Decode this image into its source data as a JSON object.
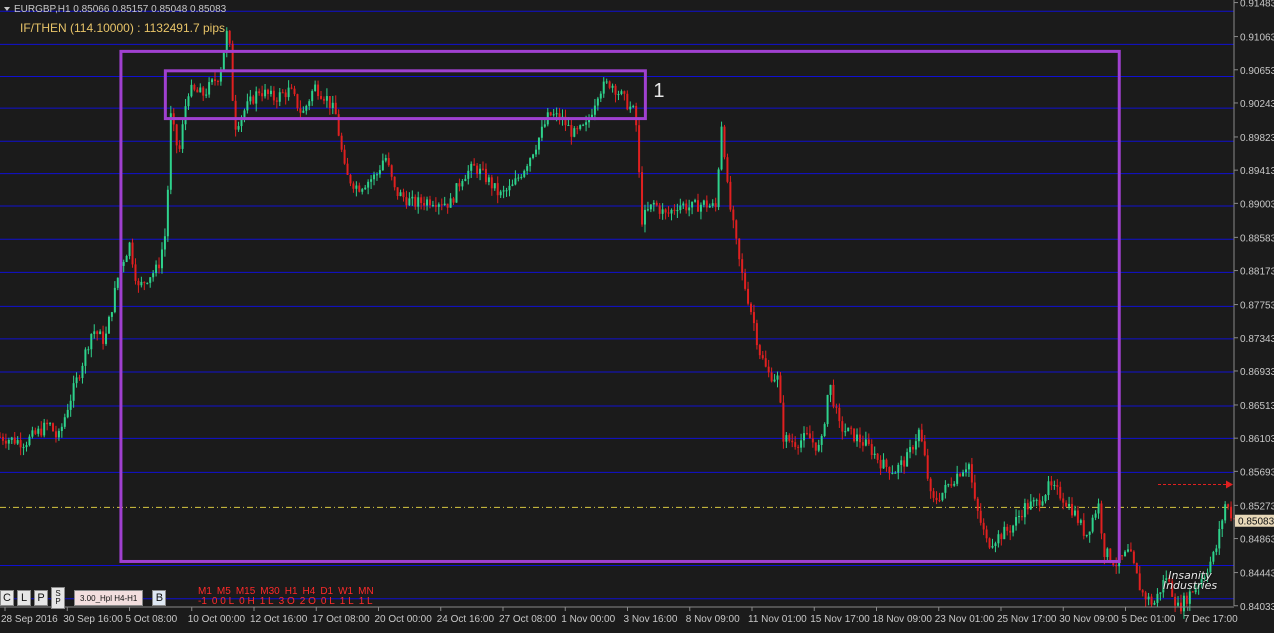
{
  "header": {
    "symbol_line": "EURGBP,H1  0.85066 0.85157 0.85048 0.85083",
    "indicator_line": "IF/THEN (114.10000) : 1132491.7 pips"
  },
  "chart_data": {
    "type": "candlestick",
    "symbol": "EURGBP",
    "timeframe": "H1",
    "ohlc_last": {
      "open": 0.85066,
      "high": 0.85157,
      "low": 0.85048,
      "close": 0.85083
    },
    "ylim": [
      0.8403,
      0.9149
    ],
    "yticks": [
      "0.91483",
      "0.91063",
      "0.90653",
      "0.90243",
      "0.89823",
      "0.89413",
      "0.89003",
      "0.88583",
      "0.88173",
      "0.87753",
      "0.87343",
      "0.86933",
      "0.86513",
      "0.86103",
      "0.85693",
      "0.85273",
      "0.84863",
      "0.84443",
      "0.84033"
    ],
    "xticks": [
      "28 Sep 2016",
      "30 Sep 16:00",
      "5 Oct 08:00",
      "10 Oct 00:00",
      "12 Oct 16:00",
      "17 Oct 08:00",
      "20 Oct 00:00",
      "24 Oct 16:00",
      "27 Oct 08:00",
      "1 Nov 00:00",
      "3 Nov 16:00",
      "8 Nov 09:00",
      "11 Nov 01:00",
      "15 Nov 17:00",
      "18 Nov 09:00",
      "23 Nov 01:00",
      "25 Nov 17:00",
      "30 Nov 09:00",
      "5 Dec 01:00",
      "7 Dec 17:00"
    ],
    "horizontal_levels": [
      0.91376,
      0.90966,
      0.9057,
      0.9018,
      0.8977,
      0.8937,
      0.8897,
      0.8856,
      0.8815,
      0.8773,
      0.8733,
      0.8692,
      0.865,
      0.861,
      0.8568,
      0.8453,
      0.8412
    ],
    "support_level": 0.85248,
    "bid_price": "0.85083",
    "path": [
      [
        0.0,
        0.8612
      ],
      [
        0.02,
        0.8605
      ],
      [
        0.04,
        0.8628
      ],
      [
        0.047,
        0.8608
      ],
      [
        0.055,
        0.865
      ],
      [
        0.064,
        0.869
      ],
      [
        0.075,
        0.8745
      ],
      [
        0.085,
        0.873
      ],
      [
        0.097,
        0.882
      ],
      [
        0.105,
        0.885
      ],
      [
        0.112,
        0.8795
      ],
      [
        0.12,
        0.881
      ],
      [
        0.128,
        0.882
      ],
      [
        0.135,
        0.887
      ],
      [
        0.138,
        0.901
      ],
      [
        0.145,
        0.896
      ],
      [
        0.152,
        0.904
      ],
      [
        0.165,
        0.9035
      ],
      [
        0.178,
        0.906
      ],
      [
        0.185,
        0.912
      ],
      [
        0.19,
        0.8995
      ],
      [
        0.198,
        0.9015
      ],
      [
        0.21,
        0.904
      ],
      [
        0.222,
        0.903
      ],
      [
        0.235,
        0.904
      ],
      [
        0.245,
        0.901
      ],
      [
        0.255,
        0.9045
      ],
      [
        0.265,
        0.903
      ],
      [
        0.272,
        0.901
      ],
      [
        0.28,
        0.8935
      ],
      [
        0.29,
        0.892
      ],
      [
        0.305,
        0.8935
      ],
      [
        0.312,
        0.896
      ],
      [
        0.32,
        0.8915
      ],
      [
        0.335,
        0.89
      ],
      [
        0.35,
        0.8905
      ],
      [
        0.365,
        0.89
      ],
      [
        0.375,
        0.8935
      ],
      [
        0.385,
        0.8945
      ],
      [
        0.395,
        0.893
      ],
      [
        0.405,
        0.891
      ],
      [
        0.415,
        0.892
      ],
      [
        0.425,
        0.8945
      ],
      [
        0.435,
        0.8975
      ],
      [
        0.445,
        0.901
      ],
      [
        0.455,
        0.9005
      ],
      [
        0.465,
        0.8985
      ],
      [
        0.475,
        0.8995
      ],
      [
        0.485,
        0.904
      ],
      [
        0.495,
        0.905
      ],
      [
        0.505,
        0.903
      ],
      [
        0.515,
        0.901
      ],
      [
        0.52,
        0.888
      ],
      [
        0.53,
        0.89
      ],
      [
        0.54,
        0.8885
      ],
      [
        0.55,
        0.89
      ],
      [
        0.56,
        0.8895
      ],
      [
        0.57,
        0.89
      ],
      [
        0.58,
        0.8895
      ],
      [
        0.585,
        0.9005
      ],
      [
        0.59,
        0.891
      ],
      [
        0.6,
        0.882
      ],
      [
        0.61,
        0.876
      ],
      [
        0.615,
        0.872
      ],
      [
        0.622,
        0.869
      ],
      [
        0.63,
        0.8685
      ],
      [
        0.635,
        0.861
      ],
      [
        0.645,
        0.8605
      ],
      [
        0.655,
        0.8612
      ],
      [
        0.665,
        0.8595
      ],
      [
        0.672,
        0.868
      ],
      [
        0.68,
        0.8625
      ],
      [
        0.695,
        0.861
      ],
      [
        0.705,
        0.8598
      ],
      [
        0.715,
        0.8578
      ],
      [
        0.725,
        0.857
      ],
      [
        0.735,
        0.8585
      ],
      [
        0.745,
        0.862
      ],
      [
        0.75,
        0.858
      ],
      [
        0.755,
        0.853
      ],
      [
        0.765,
        0.8545
      ],
      [
        0.775,
        0.8565
      ],
      [
        0.785,
        0.858
      ],
      [
        0.79,
        0.853
      ],
      [
        0.8,
        0.848
      ],
      [
        0.81,
        0.849
      ],
      [
        0.82,
        0.85
      ],
      [
        0.83,
        0.8525
      ],
      [
        0.84,
        0.853
      ],
      [
        0.85,
        0.855
      ],
      [
        0.86,
        0.854
      ],
      [
        0.87,
        0.852
      ],
      [
        0.88,
        0.849
      ],
      [
        0.89,
        0.853
      ],
      [
        0.895,
        0.847
      ],
      [
        0.905,
        0.8455
      ],
      [
        0.915,
        0.847
      ],
      [
        0.925,
        0.842
      ],
      [
        0.935,
        0.8405
      ],
      [
        0.945,
        0.844
      ],
      [
        0.955,
        0.84
      ],
      [
        0.965,
        0.842
      ],
      [
        0.975,
        0.844
      ],
      [
        0.985,
        0.847
      ],
      [
        0.993,
        0.853
      ],
      [
        1.0,
        0.851
      ]
    ],
    "annotations": [
      {
        "label": "",
        "from": 0.098,
        "to": 0.907,
        "high": 0.9088,
        "low": 0.8458
      },
      {
        "label": "1",
        "from": 0.134,
        "to": 0.523,
        "high": 0.9064,
        "low": 0.9005
      }
    ]
  },
  "colors": {
    "background": "#1b1b1b",
    "grid_line": "#1010d0",
    "bull": "#2ed28c",
    "bear": "#e02020",
    "rectangle": "#a040d0",
    "support": "#d8c840",
    "text": "#e8c468",
    "axis_text": "#c8c8c8"
  },
  "toolbar": {
    "buttons": [
      "C",
      "L",
      "P"
    ],
    "sp_top": "S",
    "sp_bottom": "P",
    "range_button": "3.00_Hpl H4-H1",
    "b_button": "B"
  },
  "timeframe_panel": {
    "labels": [
      "M1",
      "M5",
      "M15",
      "M30",
      "H1",
      "H4",
      "D1",
      "W1",
      "MN"
    ],
    "values": [
      "-1",
      "0 0 L",
      "0 H",
      "1 L",
      "3 O",
      "2 O",
      "0 L",
      "1 L",
      "1 L"
    ]
  },
  "logo_text": {
    "line1": "Insanity",
    "line2": "Industries"
  }
}
